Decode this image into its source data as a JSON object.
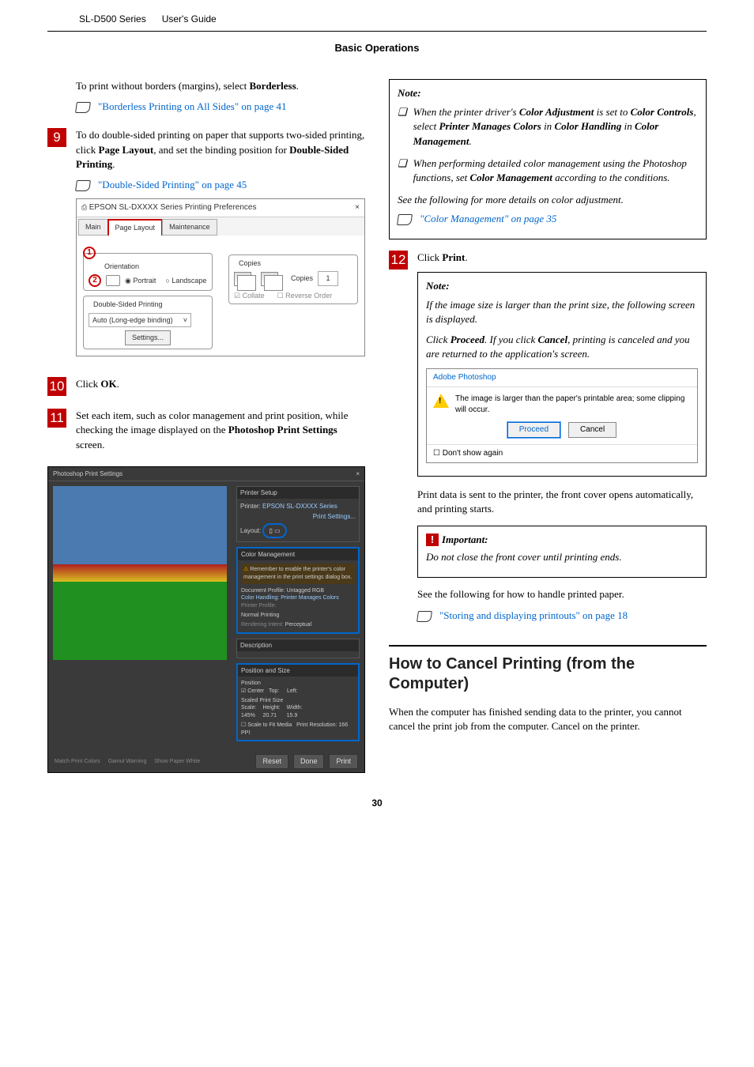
{
  "header": {
    "product": "SL-D500 Series",
    "doctype": "User's Guide"
  },
  "section": "Basic Operations",
  "page_number": "30",
  "left": {
    "intro": {
      "p1a": "To print without borders (margins), select ",
      "p1b": "Borderless",
      "link1_icon": "hand-icon",
      "link1": "\"Borderless Printing on All Sides\" on page 41"
    },
    "step9": {
      "num": "9",
      "p1a": "To do double-sided printing on paper that supports two-sided printing, click ",
      "p1b": "Page Layout",
      "p1c": ", and set the binding position for ",
      "p1d": "Double-Sided Printing",
      "link": "\"Double-Sided Printing\" on page 45",
      "ss": {
        "title": "EPSON SL-DXXXX Series Printing Preferences",
        "close": "×",
        "tabs": [
          "Main",
          "Page Layout",
          "Maintenance"
        ],
        "c1": "1",
        "orientation_label": "Orientation",
        "c2": "2",
        "portrait": "Portrait",
        "landscape": "Landscape",
        "copies_label": "Copies",
        "copies_field_label": "Copies",
        "copies_value": "1",
        "collate": "Collate",
        "reverse": "Reverse Order",
        "dsp_label": "Double-Sided Printing",
        "dsp_value": "Auto (Long-edge binding)",
        "settings_btn": "Settings..."
      }
    },
    "step10": {
      "num": "10",
      "text_a": "Click ",
      "text_b": "OK"
    },
    "step11": {
      "num": "11",
      "p_a": "Set each item, such as color management and print position, while checking the image displayed on the ",
      "p_b": "Photoshop Print Settings",
      "p_c": " screen.",
      "ps": {
        "title": "Photoshop Print Settings",
        "close": "×",
        "printer_setup": "Printer Setup",
        "printer_label": "Printer:",
        "printer_value": "EPSON SL-DXXXX Series",
        "print_settings_btn": "Print Settings...",
        "layout_label": "Layout:",
        "cm_title": "Color Management",
        "cm_warn": "Remember to enable the printer's color management in the print settings dialog box.",
        "doc_profile": "Document Profile: Untagged RGB",
        "handling_label": "Color Handling:",
        "handling_value": "Printer Manages Colors",
        "profile_label": "Printer Profile:",
        "normal": "Normal Printing",
        "intent_label": "Rendering Intent:",
        "intent_value": "Perceptual",
        "desc_title": "Description",
        "pos_title": "Position and Size",
        "pos_sub": "Position",
        "center": "Center",
        "top": "Top:",
        "left": "Left:",
        "sps": "Scaled Print Size",
        "scale": "Scale:",
        "scale_v": "145%",
        "height": "Height:",
        "height_v": "20.71",
        "width": "Width:",
        "width_v": "15.9",
        "stfm": "Scale to Fit Media",
        "res": "Print Resolution: 166 PPI",
        "bl1": "Match Print Colors",
        "bl2": "Gamut Warning",
        "bl3": "Show Paper White",
        "reset": "Reset",
        "done": "Done",
        "print": "Print"
      }
    }
  },
  "right": {
    "note1": {
      "title": "Note:",
      "li1_a": "When the printer driver's ",
      "li1_b": "Color Adjustment",
      "li1_c": " is set to ",
      "li1_d": "Color Controls",
      "li1_e": ", select ",
      "li1_f": "Printer Manages Colors",
      "li1_g": " in ",
      "li1_h": "Color Handling",
      "li1_i": " in ",
      "li1_j": "Color Management",
      "li2_a": "When performing detailed color management using the Photoshop functions, set ",
      "li2_b": "Color Management",
      "li2_c": " according to the conditions.",
      "see": "See the following for more details on color adjustment.",
      "link": "\"Color Management\" on page 35"
    },
    "step12": {
      "num": "12",
      "text_a": "Click ",
      "text_b": "Print"
    },
    "note2": {
      "title": "Note:",
      "p1": "If the image size is larger than the print size, the following screen is displayed.",
      "p2_a": "Click ",
      "p2_b": "Proceed",
      "p2_c": ". If you click ",
      "p2_d": "Cancel",
      "p2_e": ", printing is canceled and you are returned to the application's screen.",
      "dialog": {
        "title": "Adobe Photoshop",
        "msg": "The image is larger than the paper's printable area; some clipping will occur.",
        "proceed": "Proceed",
        "cancel": "Cancel",
        "dont_show": "Don't show again"
      }
    },
    "after12": "Print data is sent to the printer, the front cover opens automatically, and printing starts.",
    "important": {
      "title": "Important:",
      "body": "Do not close the front cover until printing ends."
    },
    "see_handle": "See the following for how to handle printed paper.",
    "link_store": "\"Storing and displaying printouts\" on page 18",
    "h2": "How to Cancel Printing (from the Computer)",
    "h2_body": "When the computer has finished sending data to the printer, you cannot cancel the print job from the computer. Cancel on the printer."
  }
}
